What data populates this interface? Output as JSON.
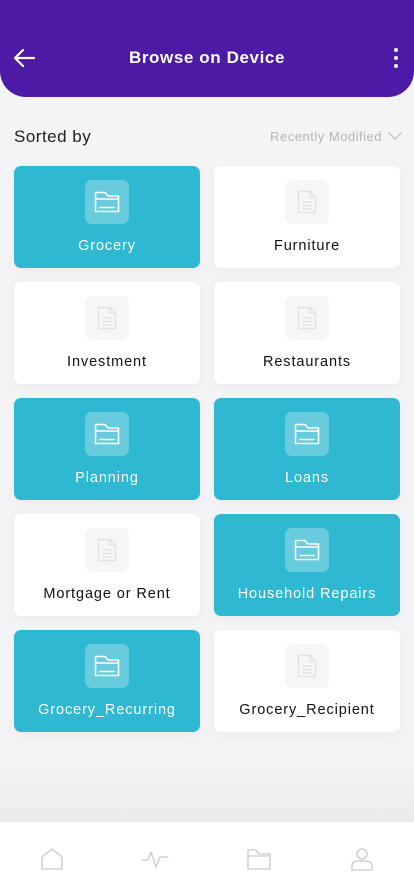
{
  "header": {
    "title": "Browse on Device",
    "background": "#4d1aa6"
  },
  "sort": {
    "label": "Sorted by",
    "selected_value": "Recently Modified"
  },
  "folders": [
    {
      "name": "Grocery",
      "selected": true,
      "icon": "folder-icon"
    },
    {
      "name": "Furniture",
      "selected": false,
      "icon": "document-icon"
    },
    {
      "name": "Investment",
      "selected": false,
      "icon": "document-icon"
    },
    {
      "name": "Restaurants",
      "selected": false,
      "icon": "document-icon"
    },
    {
      "name": "Planning",
      "selected": true,
      "icon": "folder-icon"
    },
    {
      "name": "Loans",
      "selected": true,
      "icon": "folder-icon"
    },
    {
      "name": "Mortgage or Rent",
      "selected": false,
      "icon": "document-icon"
    },
    {
      "name": "Household Repairs",
      "selected": true,
      "icon": "folder-icon"
    },
    {
      "name": "Grocery_Recurring",
      "selected": true,
      "icon": "folder-icon"
    },
    {
      "name": "Grocery_Recipient",
      "selected": false,
      "icon": "document-icon"
    }
  ],
  "colors": {
    "accent": "#2eb8d1",
    "card": "#ffffff",
    "muted": "#b5b5b8"
  },
  "tabbar": {
    "items": [
      {
        "name": "home",
        "icon": "home-icon"
      },
      {
        "name": "activity",
        "icon": "activity-icon"
      },
      {
        "name": "files",
        "icon": "folder-icon"
      },
      {
        "name": "profile",
        "icon": "person-icon"
      }
    ]
  }
}
